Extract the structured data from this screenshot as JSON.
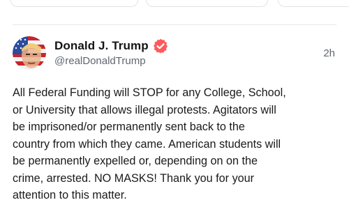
{
  "post": {
    "author": {
      "display_name": "Donald J. Trump",
      "handle": "@realDonaldTrump",
      "verified_icon": "verified-badge-icon",
      "avatar_icon": "profile-avatar"
    },
    "timestamp": "2h",
    "body": "All Federal Funding will STOP for any College, School,\nor University that allows illegal protests. Agitators will\nbe imprisoned/or permanently sent back to the\ncountry from which they came. American students will\nbe permanently expelled or, depending on on the\ncrime, arrested. NO MASKS! Thank you for your\nattention to this matter."
  },
  "colors": {
    "verified_badge": "#ff5a5a",
    "text_primary": "#141414",
    "text_secondary": "#5f6670",
    "divider": "#e6e6e9"
  }
}
